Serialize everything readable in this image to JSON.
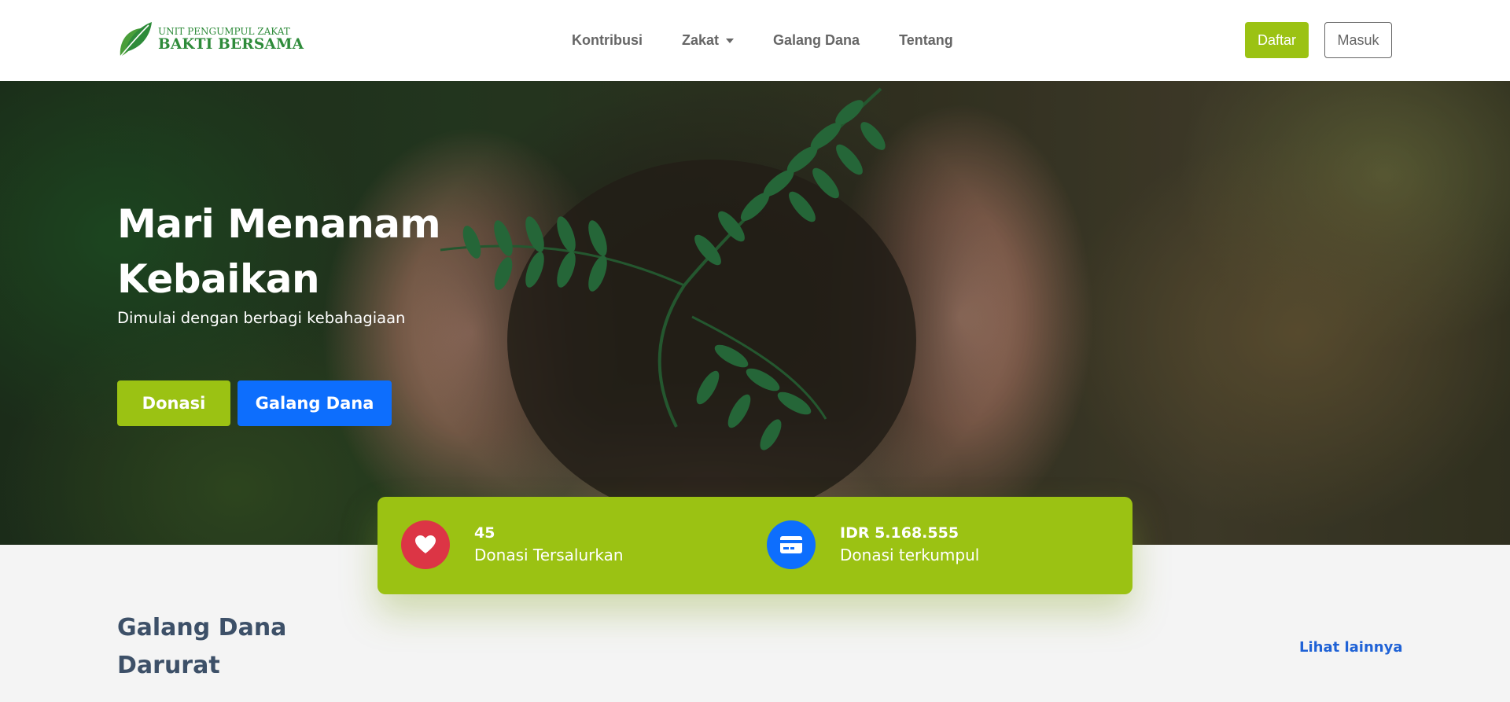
{
  "brand": {
    "line1": "UNIT PENGUMPUL ZAKAT",
    "line2": "BAKTI BERSAMA",
    "icon": "leaf-logo-icon"
  },
  "nav": {
    "items": [
      {
        "label": "Kontribusi"
      },
      {
        "label": "Zakat",
        "has_dropdown": true
      },
      {
        "label": "Galang Dana"
      },
      {
        "label": "Tentang"
      }
    ],
    "register_label": "Daftar",
    "login_label": "Masuk"
  },
  "hero": {
    "title": "Mari Menanam Kebaikan",
    "subtitle": "Dimulai dengan berbagi kebahagiaan",
    "donate_label": "Donasi",
    "fundraise_label": "Galang Dana"
  },
  "stats": [
    {
      "value": "45",
      "label": "Donasi Tersalurkan",
      "icon": "heart-icon",
      "color": "#dc3545"
    },
    {
      "value": "IDR 5.168.555",
      "label": "Donasi terkumpul",
      "icon": "credit-card-icon",
      "color": "#0d6efd"
    }
  ],
  "section": {
    "title": "Galang Dana Darurat",
    "see_more": "Lihat lainnya"
  },
  "colors": {
    "accent": "#9bc213",
    "primary": "#0d6efd",
    "danger": "#dc3545",
    "heading": "#3d5068",
    "link": "#1f62d6"
  }
}
